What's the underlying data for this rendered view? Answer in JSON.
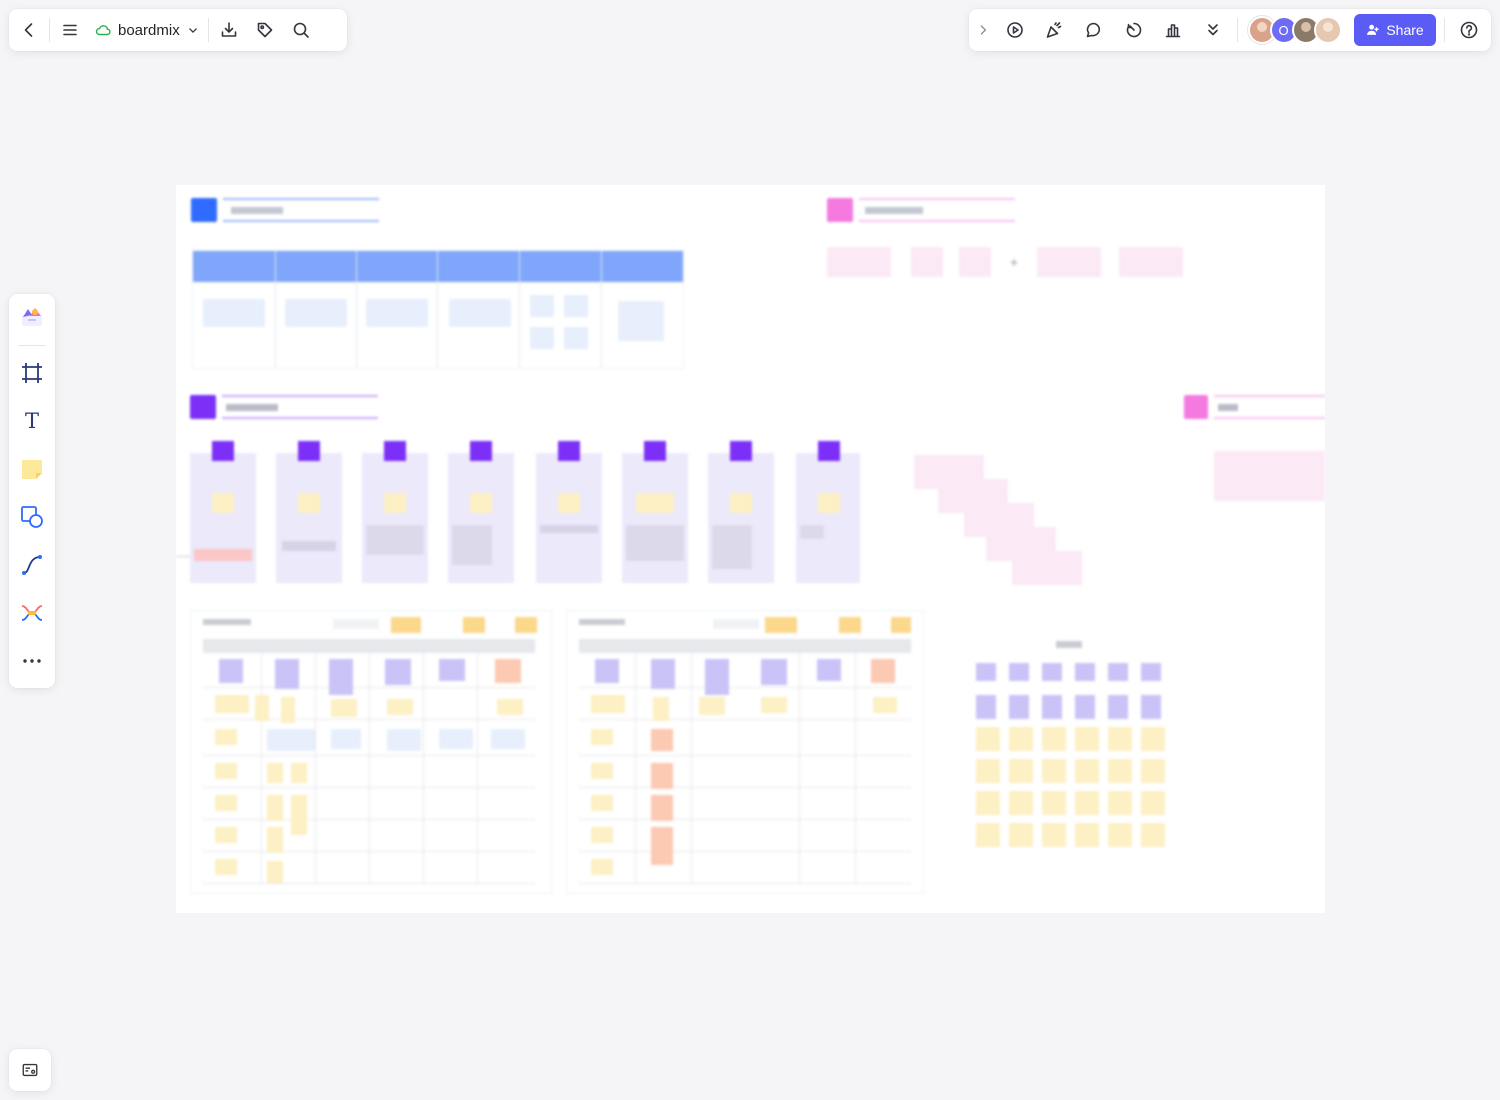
{
  "header": {
    "app_name": "boardmix",
    "share_label": "Share",
    "collaborators": [
      {
        "name": "avatar-1",
        "color": "#d9a38a"
      },
      {
        "name": "avatar-2",
        "initial": "O",
        "color": "#6d6cf6"
      },
      {
        "name": "avatar-3",
        "color": "#8b7a6a"
      },
      {
        "name": "avatar-4",
        "color": "#e6c8b0"
      }
    ]
  },
  "colors": {
    "accent": "#5b5bf5",
    "blue_section": "#2f6bff",
    "purple_section": "#7b2ff7",
    "pink_section": "#f05ad6",
    "sticky_yellow": "#fdf0c4",
    "sticky_purple": "#c9c3f7",
    "sticky_orange": "#fcc9b2"
  },
  "toolbar_icons": [
    "back-icon",
    "menu-icon",
    "cloud-icon",
    "chevron-down-icon",
    "download-icon",
    "tag-icon",
    "search-icon",
    "collapse-icon",
    "present-icon",
    "celebrate-icon",
    "comment-icon",
    "timer-icon",
    "vote-icon",
    "more-down-icon",
    "help-icon",
    "templates-icon",
    "frame-icon",
    "text-icon",
    "sticky-note-icon",
    "shape-icon",
    "connector-icon",
    "mindmap-icon",
    "more-icon",
    "minimap-icon"
  ],
  "canvas": {
    "text_tool_glyph": "T"
  }
}
